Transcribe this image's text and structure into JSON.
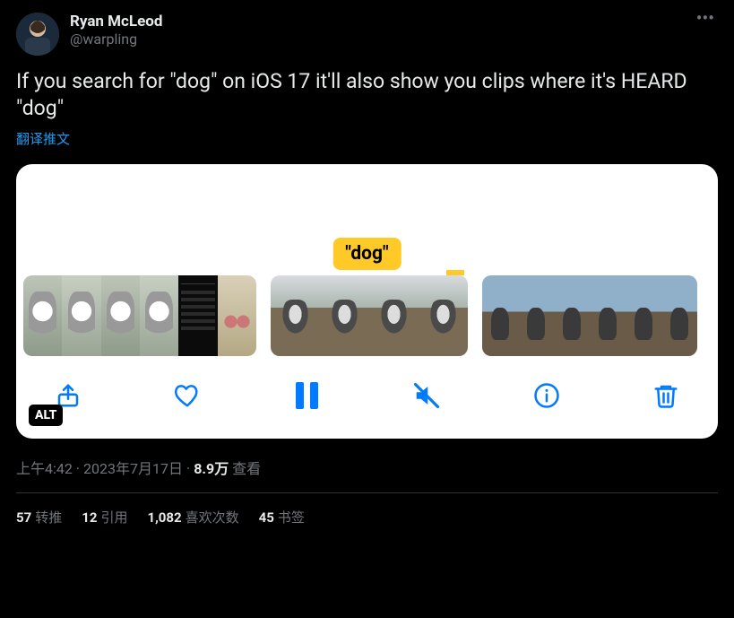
{
  "author": {
    "display_name": "Ryan McLeod",
    "handle": "@warpling"
  },
  "tweet_text": "If you search for \"dog\" on iOS 17 it'll also show you clips where it's HEARD \"dog\"",
  "translate_label": "翻译推文",
  "media": {
    "chip_label": "\"dog\"",
    "alt_badge": "ALT"
  },
  "meta": {
    "time": "上午4:42",
    "date": "2023年7月17日",
    "views_number": "8.9万",
    "views_label": "查看"
  },
  "stats": {
    "retweets": {
      "count": "57",
      "label": "转推"
    },
    "quotes": {
      "count": "12",
      "label": "引用"
    },
    "likes": {
      "count": "1,082",
      "label": "喜欢次数"
    },
    "bookmarks": {
      "count": "45",
      "label": "书签"
    }
  }
}
